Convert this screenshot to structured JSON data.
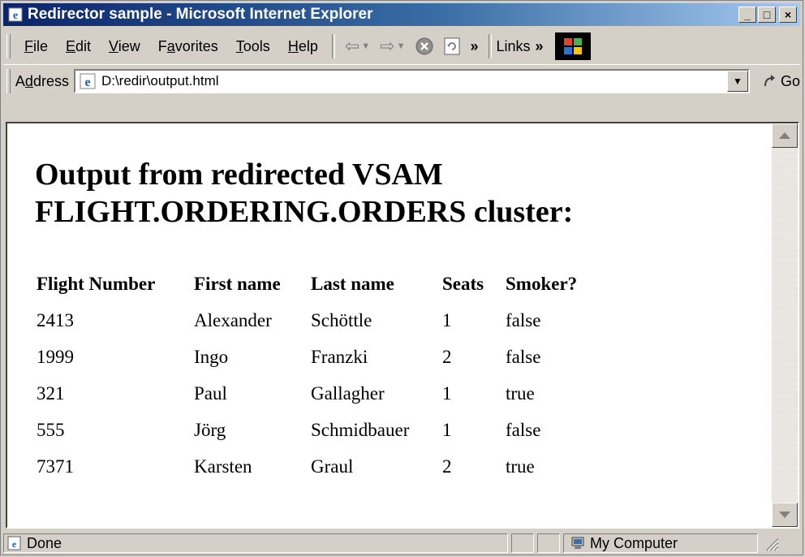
{
  "window": {
    "title": "Redirector sample - Microsoft Internet Explorer",
    "minimize": "_",
    "maximize": "□",
    "close": "×"
  },
  "menubar": {
    "items": [
      {
        "pre": "",
        "key": "F",
        "post": "ile"
      },
      {
        "pre": "",
        "key": "E",
        "post": "dit"
      },
      {
        "pre": "",
        "key": "V",
        "post": "iew"
      },
      {
        "pre": "F",
        "key": "a",
        "post": "vorites"
      },
      {
        "pre": "",
        "key": "T",
        "post": "ools"
      },
      {
        "pre": "",
        "key": "H",
        "post": "elp"
      }
    ],
    "back_glyph": "⇦",
    "forward_glyph": "⇨",
    "chevron": "»",
    "links_label": "Links"
  },
  "address": {
    "label_pre": "A",
    "label_key": "d",
    "label_post": "dress",
    "url": "D:\\redir\\output.html",
    "go_label": "Go"
  },
  "page": {
    "heading_line1": "Output from redirected VSAM",
    "heading_line2": "FLIGHT.ORDERING.ORDERS cluster:",
    "columns": [
      "Flight Number",
      "First name",
      "Last name",
      "Seats",
      "Smoker?"
    ],
    "rows": [
      [
        "2413",
        "Alexander",
        "Schöttle",
        "1",
        "false"
      ],
      [
        "1999",
        "Ingo",
        "Franzki",
        "2",
        "false"
      ],
      [
        "321",
        "Paul",
        "Gallagher",
        "1",
        "true"
      ],
      [
        "555",
        "Jörg",
        "Schmidbauer",
        "1",
        "false"
      ],
      [
        "7371",
        "Karsten",
        "Graul",
        "2",
        "true"
      ]
    ]
  },
  "status": {
    "text": "Done",
    "zone": "My Computer"
  },
  "colors": {
    "title_start": "#0a246a",
    "title_end": "#a6caf0",
    "chrome": "#d4d0c8"
  }
}
